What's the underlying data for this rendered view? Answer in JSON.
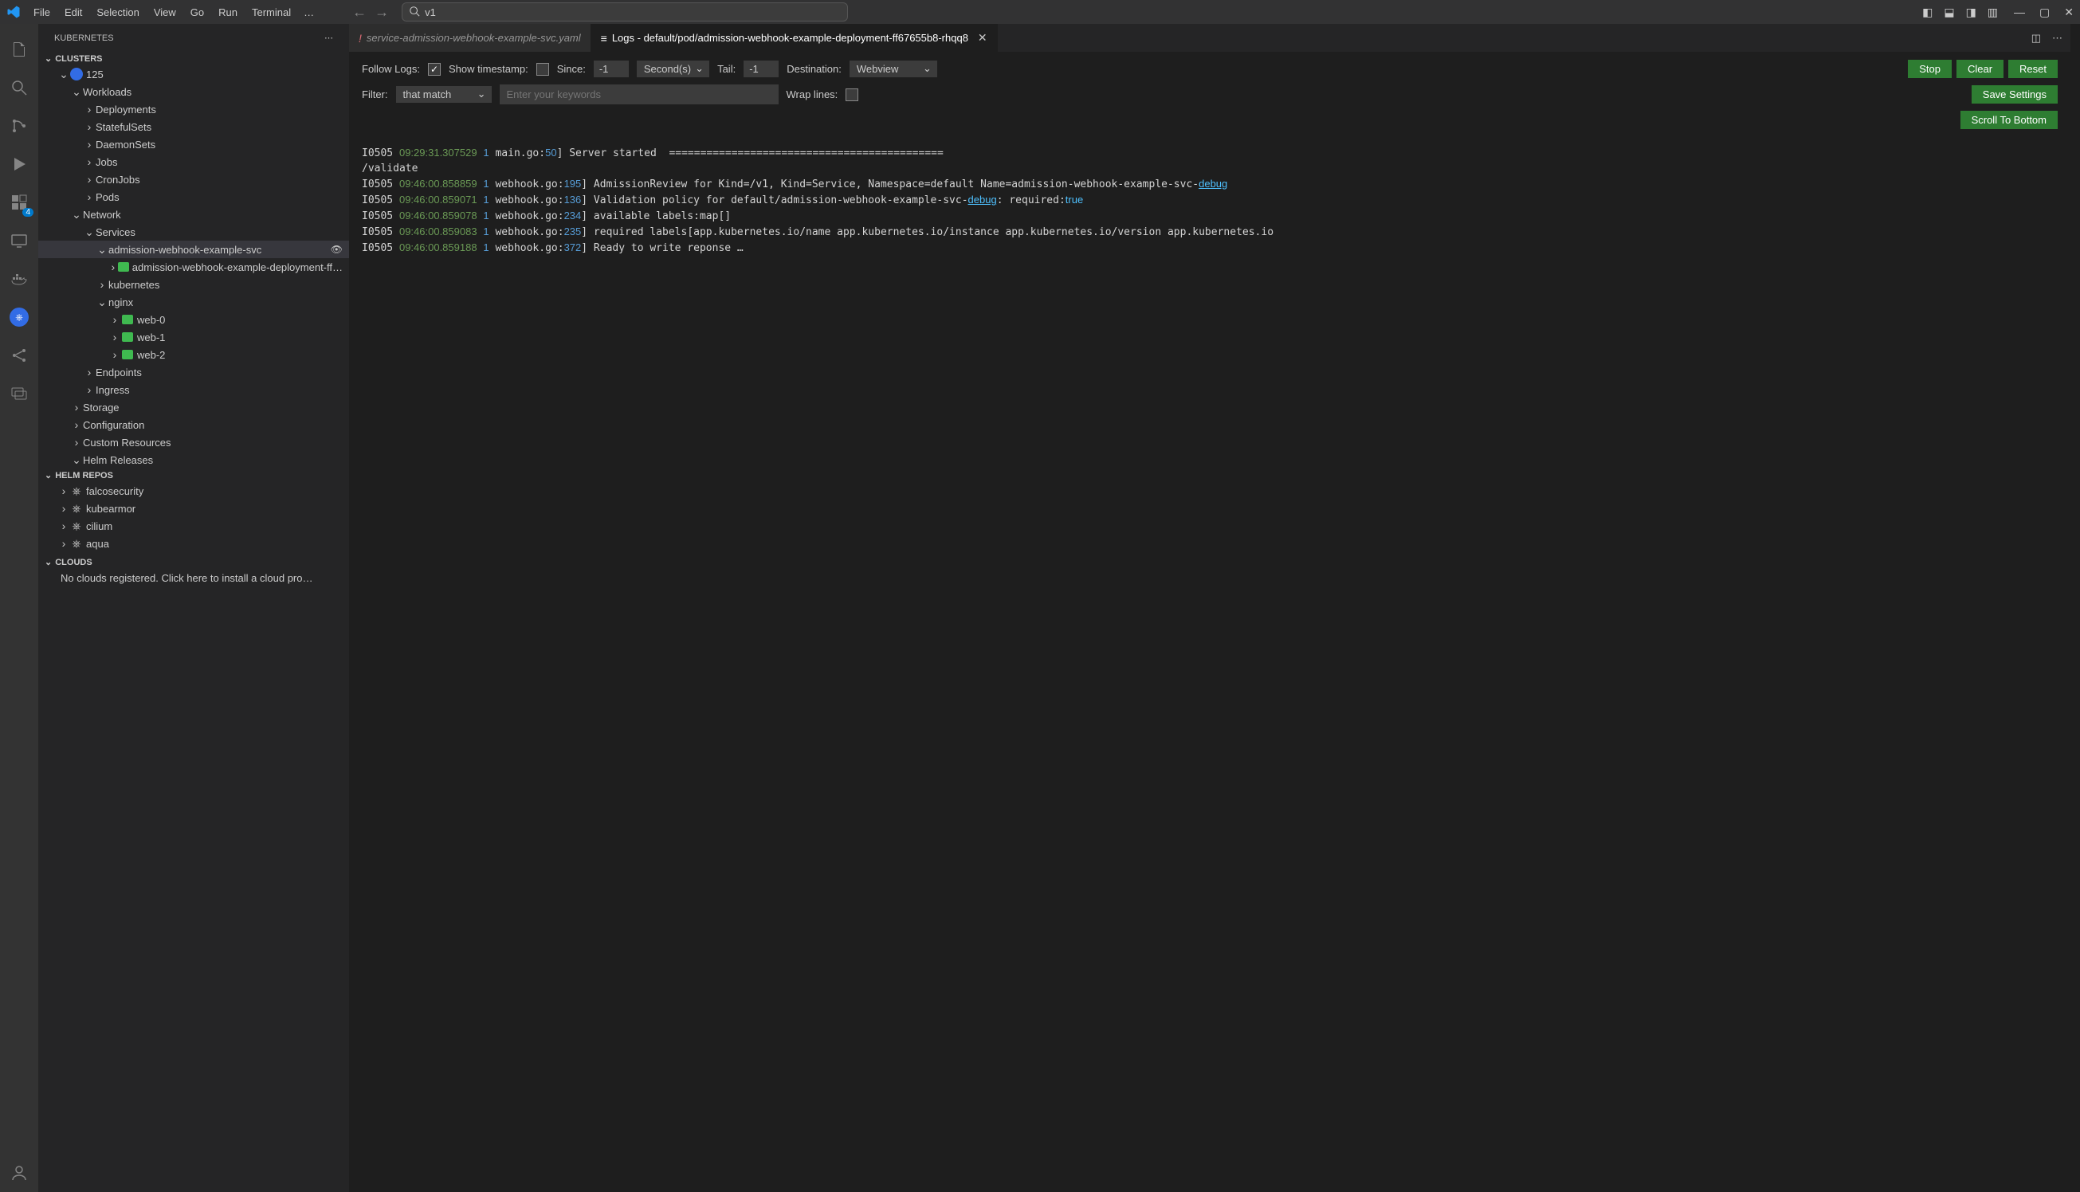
{
  "titlebar": {
    "menus": [
      "File",
      "Edit",
      "Selection",
      "View",
      "Go",
      "Run",
      "Terminal"
    ],
    "overflow": "…",
    "search_value": "v1"
  },
  "activitybar": {
    "extensions_badge": "4"
  },
  "sidebar": {
    "title": "KUBERNETES",
    "sections": {
      "clusters": "CLUSTERS",
      "helm": "HELM REPOS",
      "clouds": "CLOUDS"
    },
    "cluster_name": "125",
    "workloads": {
      "label": "Workloads",
      "items": [
        "Deployments",
        "StatefulSets",
        "DaemonSets",
        "Jobs",
        "CronJobs",
        "Pods"
      ]
    },
    "network": {
      "label": "Network",
      "services": "Services",
      "svc": "admission-webhook-example-svc",
      "dep": "admission-webhook-example-deployment-ff…",
      "kubernetes": "kubernetes",
      "nginx": "nginx",
      "web0": "web-0",
      "web1": "web-1",
      "web2": "web-2",
      "endpoints": "Endpoints",
      "ingress": "Ingress"
    },
    "storage": "Storage",
    "configuration": "Configuration",
    "custom_resources": "Custom Resources",
    "helm_releases": "Helm Releases",
    "helm_repos": [
      "falcosecurity",
      "kubearmor",
      "cilium",
      "aqua"
    ],
    "clouds_msg": "No clouds registered. Click here to install a cloud pro…"
  },
  "tabs": {
    "tab1": {
      "label": "service-admission-webhook-example-svc.yaml"
    },
    "tab2": {
      "label": "Logs - default/pod/admission-webhook-example-deployment-ff67655b8-rhqq8"
    }
  },
  "toolbar": {
    "follow": "Follow Logs:",
    "show_ts": "Show timestamp:",
    "since": "Since:",
    "since_val": "-1",
    "seconds": "Second(s)",
    "tail": "Tail:",
    "tail_val": "-1",
    "destination": "Destination:",
    "destination_val": "Webview",
    "stop": "Stop",
    "clear": "Clear",
    "reset": "Reset",
    "save": "Save Settings",
    "scroll": "Scroll To Bottom",
    "filter": "Filter:",
    "filter_mode": "that match",
    "keywords_ph": "Enter your keywords",
    "wrap": "Wrap lines:"
  },
  "logs": [
    {
      "pre": "I0505 ",
      "ts": "09:29:31.307529",
      "one": "      1",
      "file": " main.go:",
      "ln": "50",
      "rest": "] Server started  ============================================"
    },
    {
      "pre": "/validate"
    },
    {
      "pre": "I0505 ",
      "ts": "09:46:00.858859",
      "one": "      1",
      "file": " webhook.go:",
      "ln": "195",
      "rest": "] AdmissionReview for Kind=/v1, Kind=Service, Namespace=default Name=admission-webhook-example-svc-",
      "tail": "debug"
    },
    {
      "pre": "I0505 ",
      "ts": "09:46:00.859071",
      "one": "      1",
      "file": " webhook.go:",
      "ln": "136",
      "rest": "] Validation policy for default/admission-webhook-example-svc-",
      "mid": "debug",
      "rest2": ": required:",
      "tail2": "true"
    },
    {
      "pre": "I0505 ",
      "ts": "09:46:00.859078",
      "one": "      1",
      "file": " webhook.go:",
      "ln": "234",
      "rest": "] available labels:map[]"
    },
    {
      "pre": "I0505 ",
      "ts": "09:46:00.859083",
      "one": "      1",
      "file": " webhook.go:",
      "ln": "235",
      "rest": "] required labels[app.kubernetes.io/name app.kubernetes.io/instance app.kubernetes.io/version app.kubernetes.io"
    },
    {
      "pre": "I0505 ",
      "ts": "09:46:00.859188",
      "one": "      1",
      "file": " webhook.go:",
      "ln": "372",
      "rest": "] Ready to write reponse …"
    }
  ]
}
